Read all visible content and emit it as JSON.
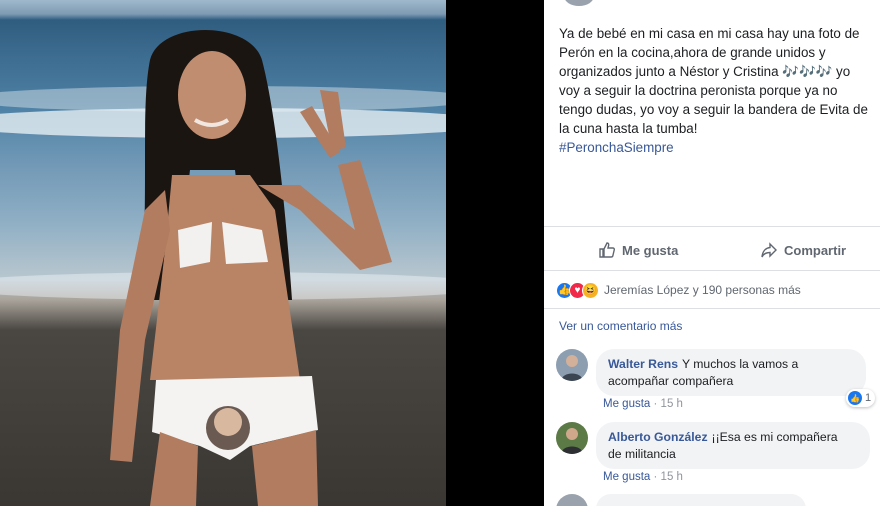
{
  "post": {
    "text_lines": [
      "Ya de bebé en mi casa en mi casa hay una foto de",
      "Perón en la cocina,ahora de grande unidos y",
      "organizados junto a Néstor y Cristina 🎶🎶🎶 yo",
      "voy a seguir la doctrina peronista porque ya no",
      "tengo dudas, yo voy a seguir la bandera de Evita de",
      "la cuna hasta la tumba!"
    ],
    "hashtag": "#PeronchaSiempre"
  },
  "actions": {
    "like_label": "Me gusta",
    "share_label": "Compartir"
  },
  "reactions": {
    "summary": "Jeremías López y 190 personas más"
  },
  "comments_section": {
    "more_label": "Ver un comentario más",
    "items": [
      {
        "author": "Walter Rens",
        "text_line1": "Y muchos la vamos a",
        "text_line2": "acompañar compañera",
        "like_label": "Me gusta",
        "time": "15 h",
        "like_count": "1"
      },
      {
        "author": "Alberto González",
        "text_line1": "¡¡Esa es mi compañera",
        "text_line2": "de militancia",
        "like_label": "Me gusta",
        "time": "15 h"
      }
    ]
  },
  "colors": {
    "link": "#385898",
    "like_blue": "#1877f2",
    "bubble_bg": "#f2f3f5"
  }
}
